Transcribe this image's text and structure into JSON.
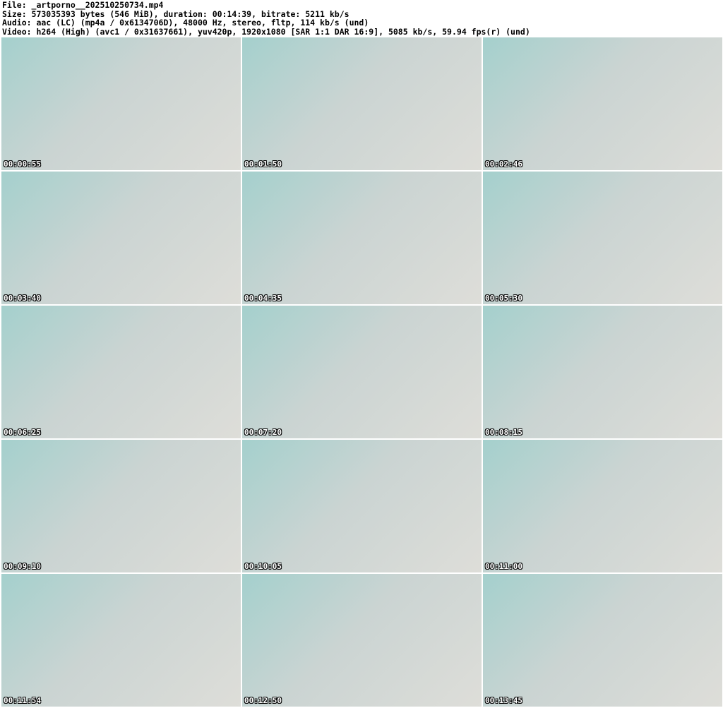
{
  "header": {
    "file": "File: _artporno__202510250734.mp4",
    "size": "Size: 573035393 bytes (546 MiB), duration: 00:14:39, bitrate: 5211 kb/s",
    "audio": "Audio: aac (LC) (mp4a / 0x6134706D), 48000 Hz, stereo, fltp, 114 kb/s (und)",
    "video": "Video: h264 (High) (avc1 / 0x31637661), yuv420p, 1920x1080 [SAR 1:1 DAR 16:9], 5085 kb/s, 59.94 fps(r) (und)"
  },
  "thumbnails": [
    {
      "timestamp": "00:00:55"
    },
    {
      "timestamp": "00:01:50"
    },
    {
      "timestamp": "00:02:46"
    },
    {
      "timestamp": "00:03:40"
    },
    {
      "timestamp": "00:04:35"
    },
    {
      "timestamp": "00:05:30"
    },
    {
      "timestamp": "00:06:25"
    },
    {
      "timestamp": "00:07:20"
    },
    {
      "timestamp": "00:08:15"
    },
    {
      "timestamp": "00:09:10"
    },
    {
      "timestamp": "00:10:05"
    },
    {
      "timestamp": "00:11:00"
    },
    {
      "timestamp": "00:11:54"
    },
    {
      "timestamp": "00:12:50"
    },
    {
      "timestamp": "00:13:45"
    }
  ]
}
